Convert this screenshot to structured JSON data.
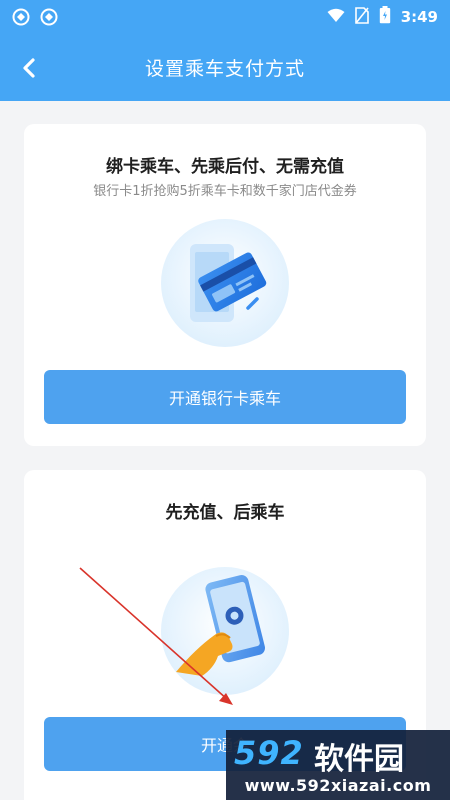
{
  "status_bar": {
    "time": "3:49",
    "icons": [
      "app-notification-icon",
      "app-notification-icon",
      "wifi-icon",
      "no-sim-icon",
      "battery-icon"
    ]
  },
  "header": {
    "title": "设置乘车支付方式",
    "back_icon": "chevron-left-icon"
  },
  "cards": [
    {
      "title": "绑卡乘车、先乘后付、无需充值",
      "subtitle": "银行卡1折抢购5折乘车卡和数千家门店代金券",
      "illustration": "bank-card-phone-illustration",
      "button_label": "开通银行卡乘车"
    },
    {
      "title": "先充值、后乘车",
      "illustration": "hand-phone-illustration",
      "button_label": "开通余额乘车",
      "button_label_visible": "开通余"
    }
  ],
  "watermark": {
    "number": "592",
    "brand": "软件园",
    "url": "www.592xiazai.com"
  },
  "colors": {
    "header": "#45a6f5",
    "button": "#4ea2ef",
    "annotation_arrow": "#d9342b",
    "background": "#f3f4f6"
  }
}
